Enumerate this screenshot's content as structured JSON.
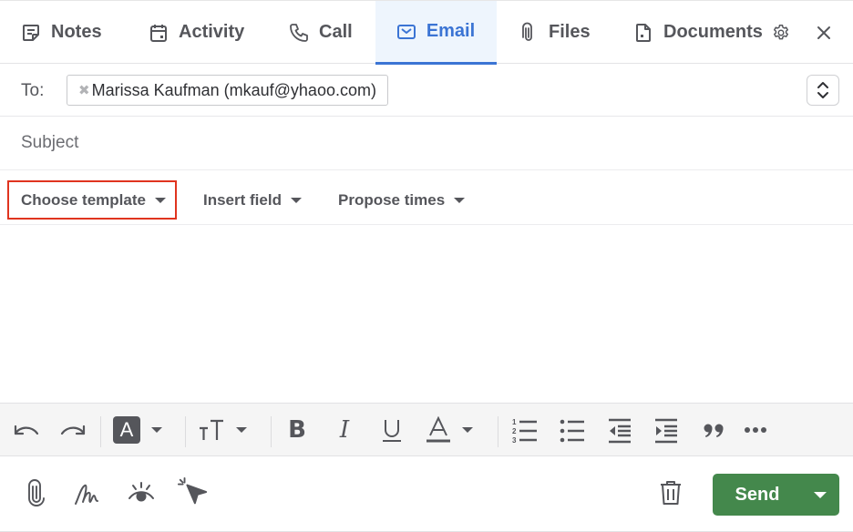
{
  "tabs": [
    {
      "id": "notes",
      "label": "Notes",
      "icon": "notes-icon",
      "active": false
    },
    {
      "id": "activity",
      "label": "Activity",
      "icon": "calendar-icon",
      "active": false
    },
    {
      "id": "call",
      "label": "Call",
      "icon": "phone-icon",
      "active": false
    },
    {
      "id": "email",
      "label": "Email",
      "icon": "envelope-icon",
      "active": true
    },
    {
      "id": "files",
      "label": "Files",
      "icon": "paperclip-icon",
      "active": false
    },
    {
      "id": "documents",
      "label": "Documents",
      "icon": "document-icon",
      "active": false
    }
  ],
  "header_actions": {
    "settings_icon": "gear-icon",
    "close_icon": "close-icon"
  },
  "compose": {
    "to_label": "To:",
    "recipients": [
      {
        "name": "Marissa Kaufman",
        "email": "mkauf@yhaoo.com",
        "display": "Marissa Kaufman (mkauf@yhaoo.com)",
        "remove_glyph": "✖"
      }
    ],
    "subject_value": "",
    "subject_placeholder": "Subject",
    "body_value": ""
  },
  "template_bar": {
    "choose_template": "Choose template",
    "insert_field": "Insert field",
    "propose_times": "Propose times",
    "highlight_color": "#e0341f"
  },
  "format_toolbar": {
    "items": [
      "undo",
      "redo",
      "text-highlight",
      "text-size",
      "bold",
      "italic",
      "underline",
      "text-color",
      "numbered-list",
      "bulleted-list",
      "outdent",
      "indent",
      "blockquote",
      "more"
    ],
    "highlight_letter": "A",
    "text_color_letter": "A",
    "bold_letter": "B",
    "italic_letter": "I",
    "underline_letter": "U",
    "text_size_label": "TT"
  },
  "footer": {
    "tools": [
      "paperclip-icon",
      "signature-icon",
      "tracking-eye-icon",
      "click-tracking-icon"
    ],
    "delete_icon": "trash-icon",
    "send_label": "Send",
    "send_color": "#44884c"
  },
  "colors": {
    "accent": "#3b74d4",
    "active_tab_bg": "#eef5fd",
    "text": "#55565b"
  }
}
